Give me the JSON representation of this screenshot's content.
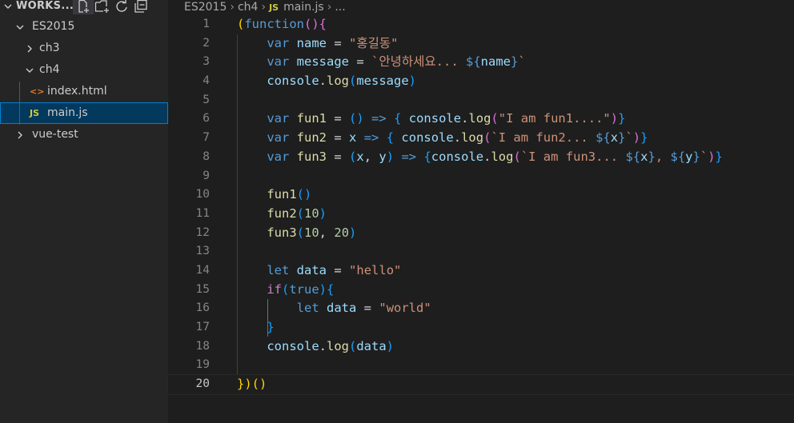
{
  "explorer": {
    "workspace_title": "WORKS...",
    "tree": [
      {
        "label": "ES2015",
        "expanded": true,
        "level": 0
      },
      {
        "label": "ch3",
        "expanded": false,
        "level": 1
      },
      {
        "label": "ch4",
        "expanded": true,
        "level": 1
      },
      {
        "label": "index.html",
        "icon": "<>",
        "level": 2
      },
      {
        "label": "main.js",
        "icon": "JS",
        "level": 2,
        "selected": true
      },
      {
        "label": "vue-test",
        "expanded": false,
        "level": 0
      }
    ]
  },
  "breadcrumb": {
    "items": [
      "ES2015",
      "ch4",
      "main.js",
      "..."
    ],
    "file_icon": "JS"
  },
  "editor": {
    "line_numbers": [
      "1",
      "2",
      "3",
      "4",
      "5",
      "6",
      "7",
      "8",
      "9",
      "10",
      "11",
      "12",
      "13",
      "14",
      "15",
      "16",
      "17",
      "18",
      "19",
      "20"
    ],
    "current_line": 20,
    "tokens": {
      "l1": [
        "(",
        "function",
        "(){"
      ],
      "l2": [
        "var",
        "name",
        "=",
        "\"홍길동\""
      ],
      "l3": [
        "var",
        "message",
        "=",
        "`안녕하세요... ",
        "${",
        "name",
        "}",
        "`"
      ],
      "l4": [
        "console",
        ".",
        "log",
        "(",
        "message",
        ")"
      ],
      "l6": [
        "var",
        "fun1",
        "=",
        "()",
        "=>",
        "{",
        "console",
        ".",
        "log",
        "(",
        "\"I am fun1....\"",
        ")",
        "}"
      ],
      "l7": [
        "var",
        "fun2",
        "=",
        "x",
        "=>",
        "{",
        "console",
        ".",
        "log",
        "(",
        "`I am fun2... ",
        "${",
        "x",
        "}",
        "`",
        ")",
        "}"
      ],
      "l8": [
        "var",
        "fun3",
        "=",
        "(",
        "x",
        ",",
        "y",
        ")",
        "=>",
        "{",
        "console",
        ".",
        "log",
        "(",
        "`I am fun3... ",
        "${",
        "x",
        "}",
        ", ",
        "${",
        "y",
        "}",
        "`",
        ")",
        "}"
      ],
      "l10": [
        "fun1",
        "()"
      ],
      "l11": [
        "fun2",
        "(",
        "10",
        ")"
      ],
      "l12": [
        "fun3",
        "(",
        "10",
        ",",
        "20",
        ")"
      ],
      "l14": [
        "let",
        "data",
        "=",
        "\"hello\""
      ],
      "l15": [
        "if",
        "(",
        "true",
        ")",
        "{"
      ],
      "l16": [
        "let",
        "data",
        "=",
        "\"world\""
      ],
      "l17": [
        "}"
      ],
      "l18": [
        "console",
        ".",
        "log",
        "(",
        "data",
        ")"
      ],
      "l20": [
        "})",
        "()"
      ]
    }
  },
  "colors": {
    "sidebar_bg": "#252526",
    "editor_bg": "#1e1e1e",
    "selection": "#04395e",
    "keyword": "#569cd6",
    "variable": "#9cdcfe",
    "string": "#ce9178",
    "function": "#dcdcaa",
    "number": "#b5cea8",
    "control": "#c586c0"
  }
}
